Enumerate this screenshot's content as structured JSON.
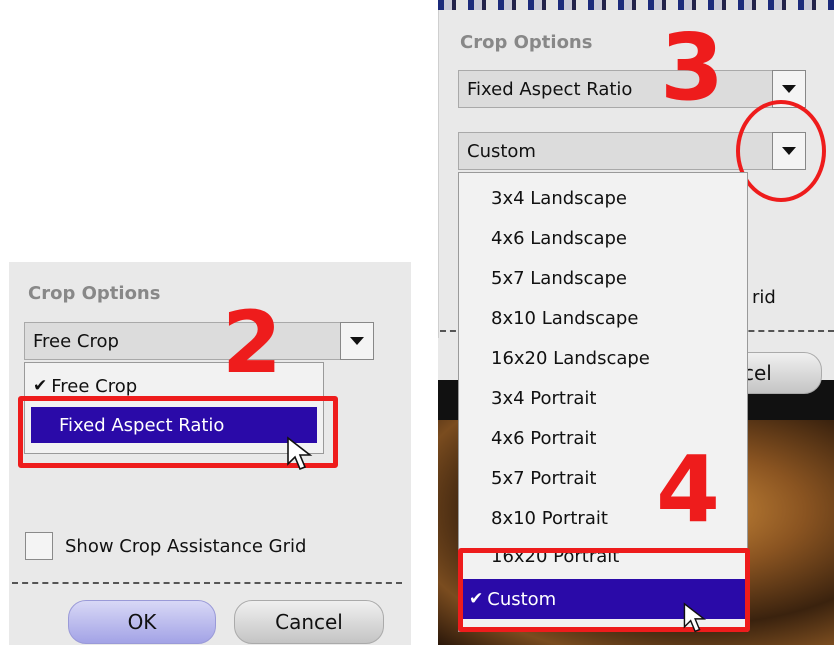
{
  "left_panel": {
    "heading": "Crop Options",
    "select_value": "Free Crop",
    "menu_items": [
      "Free Crop",
      "Fixed Aspect Ratio"
    ],
    "checked_item": "Free Crop",
    "highlighted_item": "Fixed Aspect Ratio",
    "step_label": "2",
    "checkbox_label": "Show Crop Assistance Grid",
    "ok_label": "OK",
    "cancel_label": "Cancel"
  },
  "right_panel": {
    "heading": "Crop Options",
    "select1_value": "Fixed Aspect Ratio",
    "select2_value": "Custom",
    "step3_label": "3",
    "step4_label": "4",
    "partial_grid_text": "rid",
    "partial_cancel_text": "cel",
    "menu_items": [
      "3x4 Landscape",
      "4x6 Landscape",
      "5x7 Landscape",
      "8x10 Landscape",
      "16x20 Landscape",
      "3x4 Portrait",
      "4x6 Portrait",
      "5x7 Portrait",
      "8x10 Portrait",
      "16x20 Portrait",
      "Custom"
    ],
    "checked_item": "Custom"
  },
  "colors": {
    "highlight": "#2a0aa8",
    "annotation_red": "#ee1c1c",
    "panel_bg": "#e9e9e9"
  },
  "icons": {
    "checkmark": "checkmark-icon",
    "dropdown": "chevron-down-icon",
    "cursor": "mouse-pointer-icon"
  }
}
